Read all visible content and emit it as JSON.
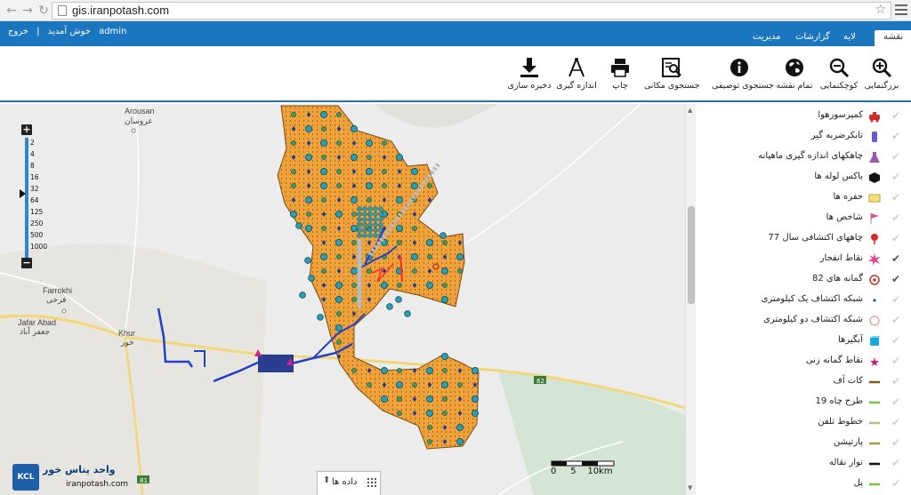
{
  "browser": {
    "url": "gis.iranpotash.com"
  },
  "header": {
    "logout": "خروج",
    "separator": "|",
    "welcome": "خوش آمدید",
    "username": "admin",
    "tabs": [
      {
        "label": "نقشه",
        "active": true
      },
      {
        "label": "لایه",
        "active": false
      },
      {
        "label": "گزارشات",
        "active": false
      },
      {
        "label": "مدیریت",
        "active": false
      }
    ]
  },
  "toolbar": {
    "tools": [
      {
        "label": "بزرگنمایی",
        "icon": "zoom-in-icon"
      },
      {
        "label": "کوچکنمایی",
        "icon": "zoom-out-icon"
      },
      {
        "label": "تمام نقشه",
        "icon": "globe-icon"
      },
      {
        "label": "جستجوی توصیفی",
        "icon": "info-icon"
      },
      {
        "label": "جستجوی مکانی",
        "icon": "spatial-search-icon"
      },
      {
        "label": "چاپ",
        "icon": "print-icon"
      },
      {
        "label": "اندازه گیری",
        "icon": "measure-icon"
      },
      {
        "label": "ذخیره سازی",
        "icon": "download-icon"
      }
    ]
  },
  "zoom": {
    "plus": "+",
    "minus": "−",
    "ticks": [
      "2",
      "4",
      "8",
      "16",
      "32",
      "64",
      "125",
      "250",
      "500",
      "1000"
    ]
  },
  "map": {
    "places": [
      {
        "en": "Arousan",
        "fa": "عروسان"
      },
      {
        "en": "Farrokhi",
        "fa": "فرخی"
      },
      {
        "en": "Jafar Abad",
        "fa": "جعفر آباد"
      },
      {
        "en": "Khur",
        "fa": "خور"
      }
    ],
    "road_labels": [
      "62",
      "81"
    ],
    "scale": "0     5    10km",
    "data_panel": "داده ها",
    "logo": {
      "mark": "KCL",
      "title": "واحد پتاس خور",
      "url": "iranpotash.com"
    }
  },
  "legend": {
    "items": [
      {
        "label": "کمپرسورهوا",
        "checked": false,
        "symbol": "compressor",
        "color": "#d62a2a"
      },
      {
        "label": "تانکرضربه گیر",
        "checked": false,
        "symbol": "tank",
        "color": "#6a5acd"
      },
      {
        "label": "چاهکهای اندازه گیری ماهیانه",
        "checked": false,
        "symbol": "flask",
        "color": "#9b59b6"
      },
      {
        "label": "باکس لوله ها",
        "checked": false,
        "symbol": "hexagon",
        "color": "#111111"
      },
      {
        "label": "حفره ها",
        "checked": false,
        "symbol": "rect",
        "color": "#f7e27a"
      },
      {
        "label": "شاخص ها",
        "checked": false,
        "symbol": "flag",
        "color": "#e74c8c"
      },
      {
        "label": "چاههای اکتشافی سال 77",
        "checked": false,
        "symbol": "pin",
        "color": "#d62a2a"
      },
      {
        "label": "نقاط انفجار",
        "checked": true,
        "symbol": "burst",
        "color": "#e84393"
      },
      {
        "label": "گمانه های 82",
        "checked": true,
        "symbol": "target",
        "color": "#c0392b"
      },
      {
        "label": "شبکه اکتشاف یک کیلومتری",
        "checked": false,
        "symbol": "dot",
        "color": "#1f3a93"
      },
      {
        "label": "شبکه اکتشاف دو کیلومتری",
        "checked": false,
        "symbol": "ring",
        "color": "#e89a9a"
      },
      {
        "label": "آبگیرها",
        "checked": false,
        "symbol": "cube",
        "color": "#1fa6e0"
      },
      {
        "label": "نقاط گمانه زنی",
        "checked": false,
        "symbol": "star",
        "color": "#c2187d"
      },
      {
        "label": "کات آف",
        "checked": false,
        "symbol": "line",
        "color": "#7a5a1e"
      },
      {
        "label": "طرح چاه 19",
        "checked": false,
        "symbol": "line",
        "color": "#7cc242"
      },
      {
        "label": "خطوط تلفن",
        "checked": false,
        "symbol": "line",
        "color": "#a8c878"
      },
      {
        "label": "پارتیشن",
        "checked": false,
        "symbol": "line",
        "color": "#a0a040"
      },
      {
        "label": "نوار نقاله",
        "checked": false,
        "symbol": "line",
        "color": "#111111"
      },
      {
        "label": "پل",
        "checked": false,
        "symbol": "line",
        "color": "#7cc242"
      }
    ]
  }
}
